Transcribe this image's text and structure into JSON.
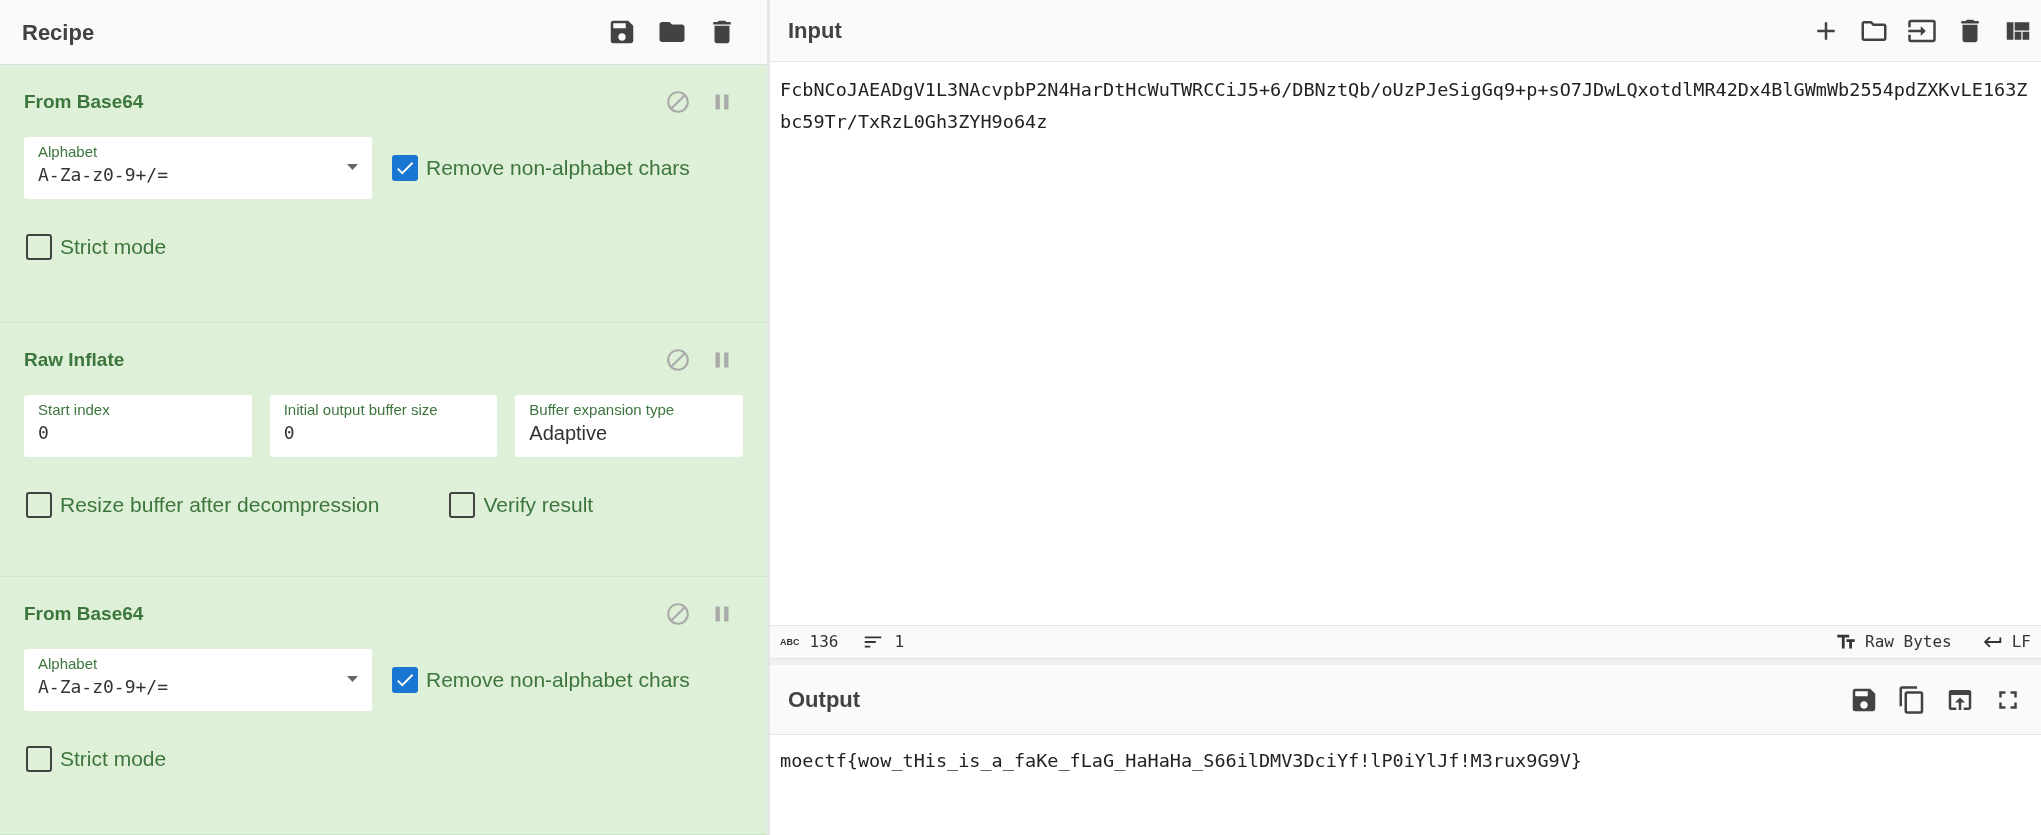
{
  "recipe": {
    "title": "Recipe",
    "operations": [
      {
        "name": "From Base64",
        "settings": [
          {
            "kind": "dropdown",
            "label": "Alphabet",
            "value": "A-Za-z0-9+/="
          },
          {
            "kind": "checkbox",
            "label": "Remove non-alphabet chars",
            "checked": true
          },
          {
            "kind": "checkbox",
            "label": "Strict mode",
            "checked": false
          }
        ]
      },
      {
        "name": "Raw Inflate",
        "settings": [
          {
            "kind": "number",
            "label": "Start index",
            "value": "0"
          },
          {
            "kind": "number",
            "label": "Initial output buffer size",
            "value": "0"
          },
          {
            "kind": "select",
            "label": "Buffer expansion type",
            "value": "Adaptive"
          },
          {
            "kind": "checkbox",
            "label": "Resize buffer after decompression",
            "checked": false
          },
          {
            "kind": "checkbox",
            "label": "Verify result",
            "checked": false
          }
        ]
      },
      {
        "name": "From Base64",
        "settings": [
          {
            "kind": "dropdown",
            "label": "Alphabet",
            "value": "A-Za-z0-9+/="
          },
          {
            "kind": "checkbox",
            "label": "Remove non-alphabet chars",
            "checked": true
          },
          {
            "kind": "checkbox",
            "label": "Strict mode",
            "checked": false
          }
        ]
      }
    ]
  },
  "input": {
    "title": "Input",
    "text": "FcbNCoJAEADgV1L3NAcvpbP2N4HarDtHcWuTWRCCiJ5+6/DBNztQb/oUzPJeSigGq9+p+sO7JDwLQxotdlMR42Dx4BlGWmWb2554pdZXKvLE163Zbc59Tr/TxRzL0Gh3ZYH9o64z",
    "chars_icon": "ABC",
    "chars": "136",
    "lines": "1",
    "encoding": "Raw Bytes",
    "eol": "LF"
  },
  "output": {
    "title": "Output",
    "text": "moectf{wow_tHis_is_a_faKe_fLaG_HaHaHa_S66ilDMV3DciYf!lP0iYlJf!M3rux9G9V}"
  }
}
